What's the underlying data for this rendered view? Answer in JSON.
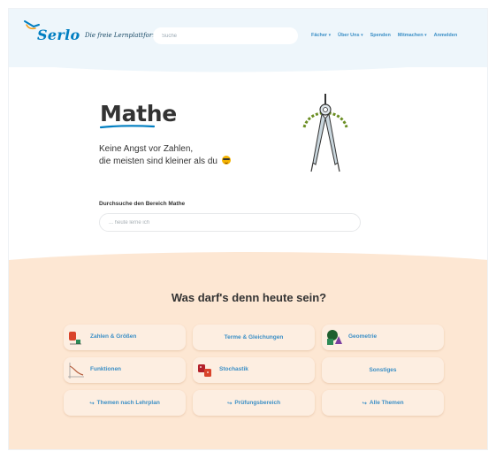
{
  "header": {
    "logo_text": "Serlo",
    "tagline": "Die freie Lernplattform",
    "search_placeholder": "Suche",
    "nav": [
      {
        "label": "Fächer",
        "dropdown": true
      },
      {
        "label": "Über Uns",
        "dropdown": true
      },
      {
        "label": "Spenden",
        "dropdown": false
      },
      {
        "label": "Mitmachen",
        "dropdown": true
      },
      {
        "label": "Anmelden",
        "dropdown": false
      }
    ]
  },
  "hero": {
    "title": "Mathe",
    "subtitle_line1": "Keine Angst vor Zahlen,",
    "subtitle_line2": "die meisten sind kleiner als du",
    "emoji": "cool-face-emoji",
    "illustration": "compass-icon"
  },
  "search": {
    "label": "Durchsuche den Bereich Mathe",
    "placeholder": "... heute lerne ich"
  },
  "topics": {
    "heading": "Was darf's denn heute sein?",
    "cards": [
      {
        "label": "Zahlen & Größen",
        "icon": "numbers-icon"
      },
      {
        "label": "Terme & Gleichungen",
        "icon": ""
      },
      {
        "label": "Geometrie",
        "icon": "shapes-icon"
      },
      {
        "label": "Funktionen",
        "icon": "graph-icon"
      },
      {
        "label": "Stochastik",
        "icon": "dice-icon"
      },
      {
        "label": "Sonstiges",
        "icon": ""
      },
      {
        "label": "Themen nach Lehrplan",
        "icon": "arrow-icon"
      },
      {
        "label": "Prüfungsbereich",
        "icon": "arrow-icon"
      },
      {
        "label": "Alle Themen",
        "icon": "arrow-icon"
      }
    ],
    "arrow_glyph": "↪"
  },
  "colors": {
    "brand_blue": "#007ec1",
    "link_blue": "#3b8fc6",
    "header_bg": "#eef6fb",
    "bottom_bg": "#fde7d3"
  }
}
